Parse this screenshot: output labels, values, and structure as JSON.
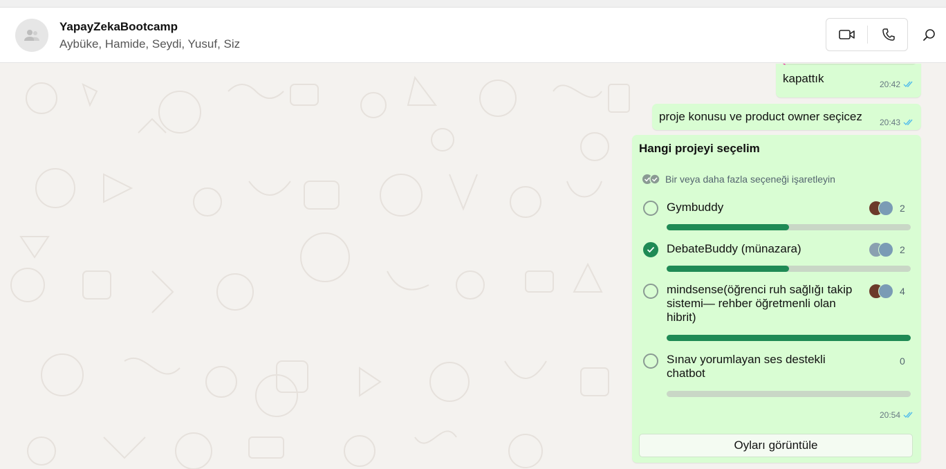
{
  "header": {
    "title": "YapayZekaBootcamp",
    "members": "Aybüke, Hamide, Seydi, Yusuf, Siz"
  },
  "icons": {
    "avatar": "group-avatar-icon",
    "video": "video-call-icon",
    "voice": "voice-call-icon",
    "search": "search-icon"
  },
  "messages": [
    {
      "text": "kapattık",
      "time": "20:42",
      "status": "read"
    },
    {
      "text": "proje konusu ve product owner seçicez",
      "time": "20:43",
      "status": "read"
    }
  ],
  "poll": {
    "question": "Hangi projeyi seçelim",
    "hint": "Bir veya daha fazla seçeneği işaretleyin",
    "options": [
      {
        "label": "Gymbuddy",
        "count": "2",
        "fraction": 0.5,
        "checked": false
      },
      {
        "label": "DebateBuddy (münazara)",
        "count": "2",
        "fraction": 0.5,
        "checked": true
      },
      {
        "label": "mindsense(öğrenci ruh sağlığı takip sistemi— rehber öğretmenli olan hibrit)",
        "count": "4",
        "fraction": 1.0,
        "checked": false
      },
      {
        "label": "Sınav yorumlayan ses destekli chatbot",
        "count": "0",
        "fraction": 0.0,
        "checked": false
      }
    ],
    "time": "20:54",
    "view_votes_label": "Oyları görüntüle"
  },
  "colors": {
    "outgoing_bubble": "#d9fdd3",
    "accent_green": "#1f8a55",
    "read_tick": "#53bdeb",
    "quote_bar": "#e542a3"
  }
}
